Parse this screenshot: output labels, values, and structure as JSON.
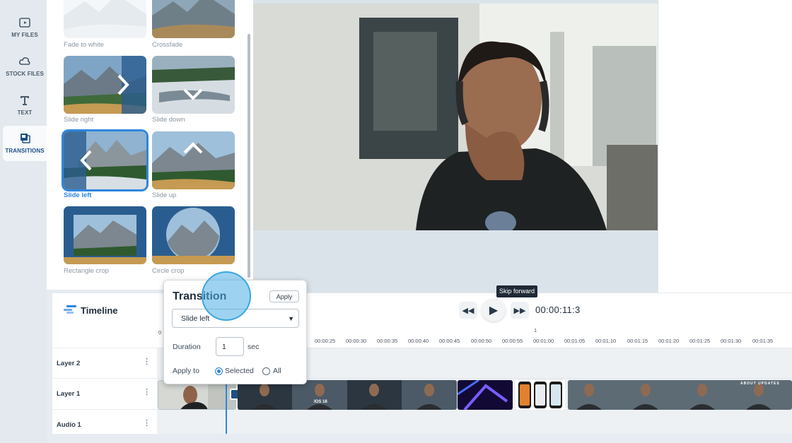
{
  "nav": {
    "items": [
      {
        "label": "MY FILES",
        "icon": "my-files-icon"
      },
      {
        "label": "STOCK FILES",
        "icon": "cloud-icon"
      },
      {
        "label": "TEXT",
        "icon": "text-icon"
      },
      {
        "label": "TRANSITIONS",
        "icon": "transitions-icon",
        "active": true
      }
    ]
  },
  "transitions": {
    "items": [
      {
        "label": "Fade to white"
      },
      {
        "label": "Crossfade"
      },
      {
        "label": "Slide right"
      },
      {
        "label": "Slide down"
      },
      {
        "label": "Slide left",
        "selected": true
      },
      {
        "label": "Slide up"
      },
      {
        "label": "Rectangle crop"
      },
      {
        "label": "Circle crop"
      }
    ]
  },
  "tooltip": "Skip forward",
  "timeline": {
    "title": "Timeline",
    "time": "00:00:11:3",
    "ruler": [
      "0",
      "00:00:25",
      "00:00:30",
      "00:00:35",
      "00:00:40",
      "00:00:45",
      "00:00:50",
      "00:00:55",
      "00:01:00",
      "00:01:05",
      "00:01:10",
      "00:01:15",
      "00:01:20",
      "00:01:25",
      "00:01:30",
      "00:01:35"
    ],
    "ruler_marker": "1",
    "layers": [
      "Layer 2",
      "Layer 1",
      "Audio 1"
    ],
    "clip_caption": "IOS 18",
    "clip_end_caption": "ABOUT UPDATES"
  },
  "popup": {
    "title": "Transition",
    "apply_label": "Apply",
    "selected_type": "Slide left",
    "duration_label": "Duration",
    "duration_value": "1",
    "duration_unit": "sec",
    "apply_to_label": "Apply to",
    "options": [
      "Selected",
      "All"
    ],
    "selected_option": "Selected"
  },
  "colors": {
    "accent": "#2e86de",
    "nav_bg": "#e3e9ee",
    "tooltip_bg": "#1f2a36"
  }
}
